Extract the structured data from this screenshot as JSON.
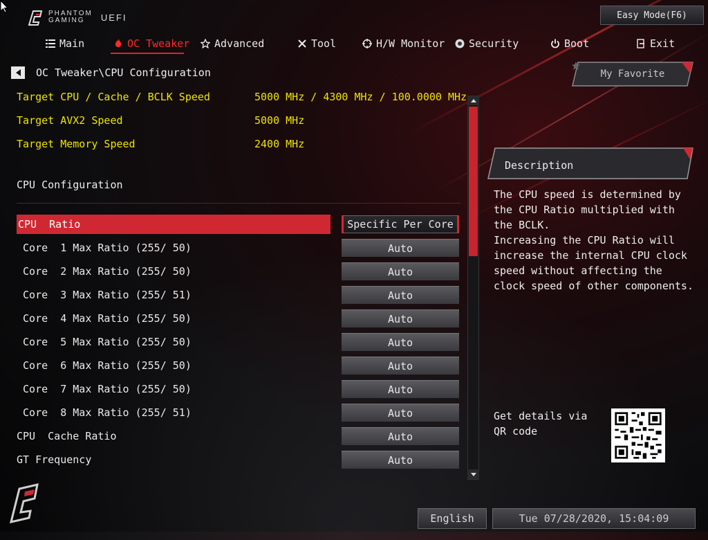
{
  "brand": {
    "line1": "PHANTOM",
    "line2": "GAMING",
    "uefi": "UEFI"
  },
  "easy_mode": "Easy Mode(F6)",
  "nav": [
    {
      "label": "Main",
      "icon": "list-icon"
    },
    {
      "label": "OC Tweaker",
      "icon": "flame-icon",
      "active": true
    },
    {
      "label": "Advanced",
      "icon": "star-icon"
    },
    {
      "label": "Tool",
      "icon": "tools-icon"
    },
    {
      "label": "H/W Monitor",
      "icon": "crosshair-icon"
    },
    {
      "label": "Security",
      "icon": "shield-icon"
    },
    {
      "label": "Boot",
      "icon": "power-icon"
    },
    {
      "label": "Exit",
      "icon": "exit-icon"
    }
  ],
  "breadcrumb": "OC Tweaker\\CPU Configuration",
  "info": [
    {
      "label": "Target CPU / Cache / BCLK Speed",
      "value": "5000 MHz / 4300 MHz / 100.0000 MHz"
    },
    {
      "label": "Target AVX2 Speed",
      "value": "5000 MHz"
    },
    {
      "label": "Target Memory Speed",
      "value": "2400 MHz"
    }
  ],
  "section_title": "CPU Configuration",
  "rows": [
    {
      "label": "CPU  Ratio",
      "value": "Specific Per Core",
      "selected": true
    },
    {
      "label": " Core  1 Max Ratio (255/ 50)",
      "value": "Auto"
    },
    {
      "label": " Core  2 Max Ratio (255/ 50)",
      "value": "Auto"
    },
    {
      "label": " Core  3 Max Ratio (255/ 51)",
      "value": "Auto"
    },
    {
      "label": " Core  4 Max Ratio (255/ 50)",
      "value": "Auto"
    },
    {
      "label": " Core  5 Max Ratio (255/ 50)",
      "value": "Auto"
    },
    {
      "label": " Core  6 Max Ratio (255/ 50)",
      "value": "Auto"
    },
    {
      "label": " Core  7 Max Ratio (255/ 50)",
      "value": "Auto"
    },
    {
      "label": " Core  8 Max Ratio (255/ 51)",
      "value": "Auto"
    },
    {
      "label": "CPU  Cache Ratio",
      "value": "Auto"
    },
    {
      "label": "GT Frequency",
      "value": "Auto"
    }
  ],
  "my_favorite": "My Favorite",
  "description": {
    "title": "Description",
    "p1": "The CPU speed is determined by the CPU Ratio multiplied with the BCLK.",
    "p2": "Increasing the CPU Ratio will increase the internal CPU clock speed without affecting the clock speed of other components."
  },
  "qr_text": "Get details via QR code",
  "language": "English",
  "datetime": "Tue 07/28/2020, 15:04:09",
  "colors": {
    "accent": "#d02832",
    "info_text": "#f0e400",
    "active_tab": "#ff2a2a"
  }
}
